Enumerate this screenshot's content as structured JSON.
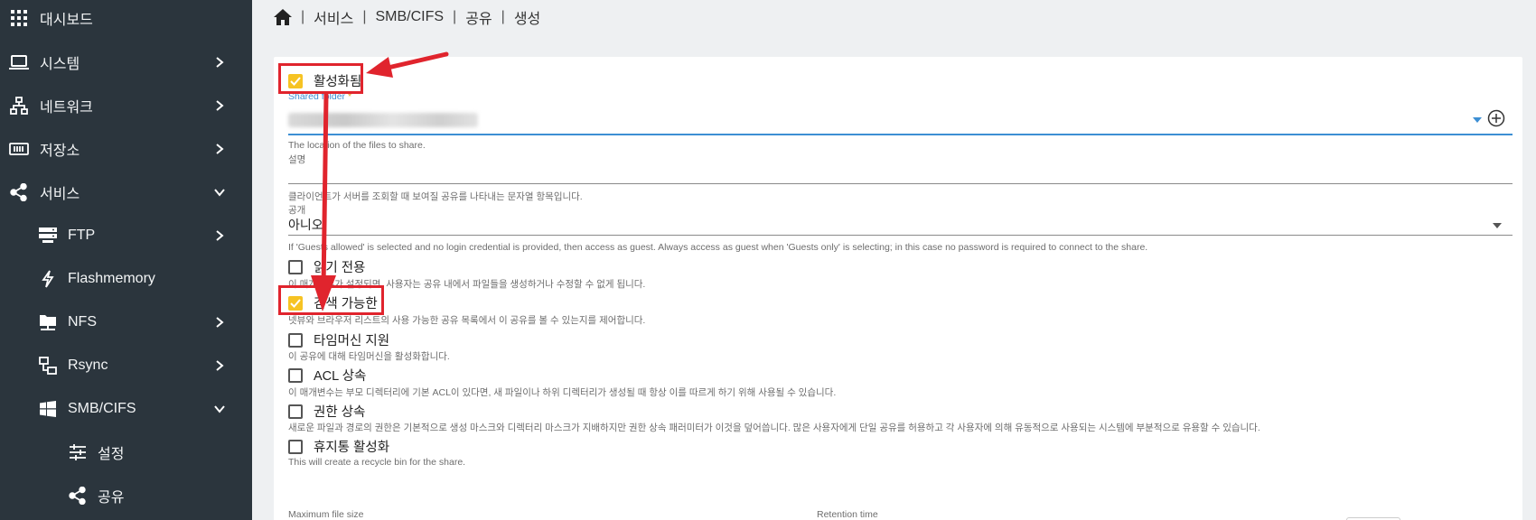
{
  "sidebar": {
    "items": [
      {
        "icon": "grid-icon",
        "label": "대시보드"
      },
      {
        "icon": "laptop-icon",
        "label": "시스템"
      },
      {
        "icon": "network-icon",
        "label": "네트워크"
      },
      {
        "icon": "storage-icon",
        "label": "저장소"
      },
      {
        "icon": "share-icon",
        "label": "서비스"
      },
      {
        "icon": "server-icon",
        "label": "FTP"
      },
      {
        "icon": "flash-icon",
        "label": "Flashmemory"
      },
      {
        "icon": "folder-network-icon",
        "label": "NFS"
      },
      {
        "icon": "sync-icon",
        "label": "Rsync"
      },
      {
        "icon": "windows-icon",
        "label": "SMB/CIFS"
      },
      {
        "icon": "settings-sliders-icon",
        "label": "설정"
      },
      {
        "icon": "share-icon",
        "label": "공유"
      }
    ]
  },
  "breadcrumb": {
    "home_icon": "home-icon",
    "items": [
      "서비스",
      "SMB/CIFS",
      "공유",
      "생성"
    ]
  },
  "form": {
    "enabled": {
      "label": "활성화됨",
      "checked": true
    },
    "shared_folder": {
      "label": "Shared folder",
      "required_mark": "*",
      "hint": "The location of the files to share."
    },
    "description": {
      "label": "설명",
      "hint": "클라이언트가 서버를 조회할 때 보여질 공유를 나타내는 문자열 항목입니다."
    },
    "public": {
      "label": "공개",
      "value": "아니오",
      "hint": "If 'Guests allowed' is selected and no login credential is provided, then access as guest. Always access as guest when 'Guests only' is selecting; in this case no password is required to connect to the share."
    },
    "readonly": {
      "label": "읽기 전용",
      "checked": false,
      "hint": "이 매개변수가 설정되면, 사용자는 공유 내에서 파일들을 생성하거나 수정할 수 없게 됩니다."
    },
    "browseable": {
      "label": "검색 가능한",
      "checked": true,
      "hint": "넷뷰와 브라우저 리스트의 사용 가능한 공유 목록에서 이 공유를 볼 수 있는지를 제어합니다."
    },
    "timemachine": {
      "label": "타임머신 지원",
      "checked": false,
      "hint": "이 공유에 대해 타임머신을 활성화합니다."
    },
    "inherit_acls": {
      "label": "ACL 상속",
      "checked": false,
      "hint": "이 매개변수는 부모 디렉터리에 기본 ACL이 있다면, 새 파일이나 하위 디렉터리가 생성될 때 항상 이를 따르게 하기 위해 사용될 수 있습니다."
    },
    "inherit_permissions": {
      "label": "권한 상속",
      "checked": false,
      "hint": "새로운 파일과 경로의 권한은 기본적으로 생성 마스크와 디렉터리 마스크가 지배하지만 권한 상속 패러미터가 이것을 덮어씁니다. 많은 사용자에게 단일 공유를 허용하고 각 사용자에 의해 유동적으로 사용되는 시스템에 부분적으로 유용할 수 있습니다."
    },
    "recycle_bin": {
      "label": "휴지통 활성화",
      "checked": false,
      "hint": "This will create a recycle bin for the share."
    },
    "max_file_size": {
      "label": "Maximum file size"
    },
    "retention_time": {
      "label": "Retention time"
    }
  },
  "colors": {
    "sidebar_bg": "#2b353d",
    "accent_blue": "#3d8fd4",
    "checkbox_yellow": "#f6c323",
    "annotation_red": "#e0242d"
  }
}
